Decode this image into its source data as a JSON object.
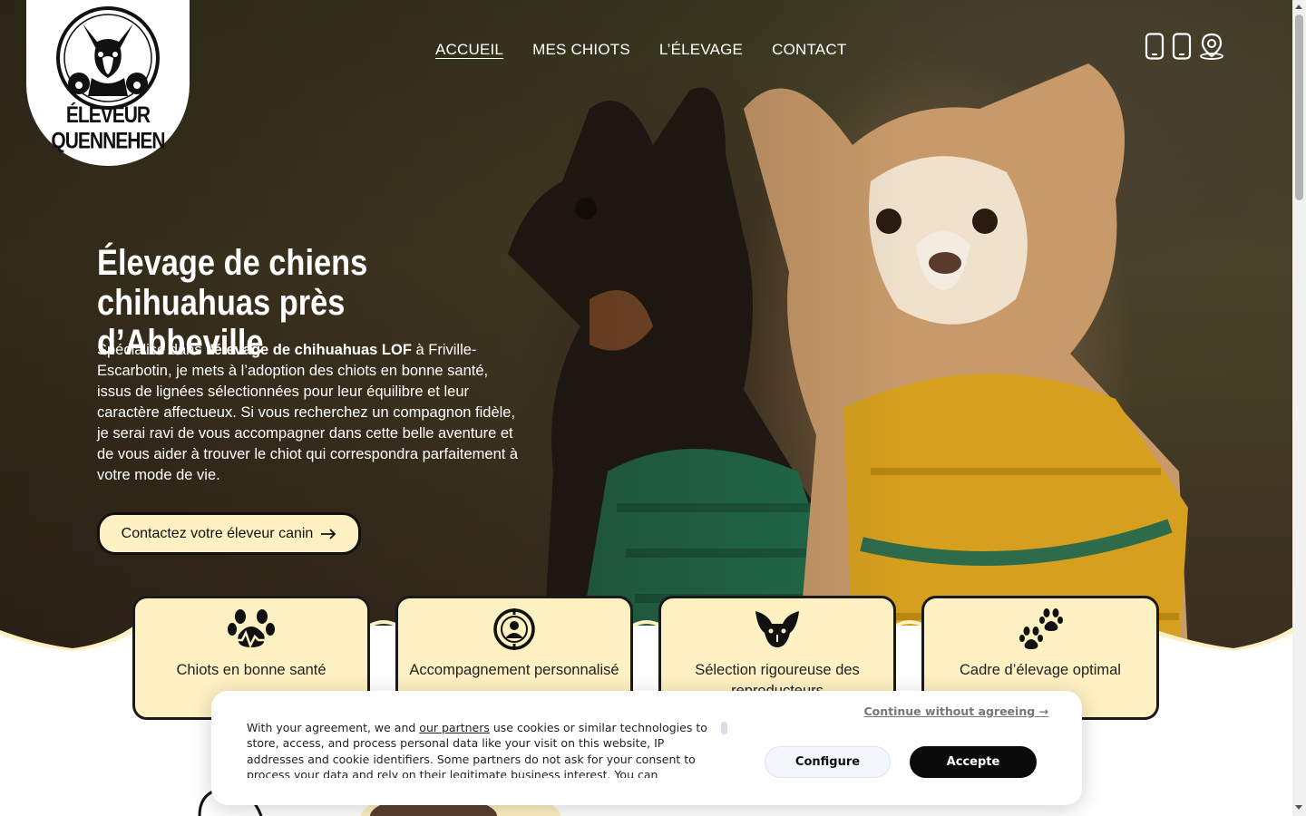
{
  "brand": {
    "name": "ÉLEVEUR QUENNEHEN"
  },
  "nav": {
    "items": [
      {
        "label": "ACCUEIL",
        "active": true
      },
      {
        "label": "MES CHIOTS",
        "active": false
      },
      {
        "label": "L’ÉLEVAGE",
        "active": false
      },
      {
        "label": "CONTACT",
        "active": false
      }
    ]
  },
  "top_icons": [
    "phone-icon",
    "mobile-icon",
    "location-pin-icon"
  ],
  "hero": {
    "title": "Élevage de chiens chihuahuas près d’Abbeville",
    "text_before": "Spécialisé dans ",
    "text_bold": "l'élevage de chihuahuas LOF",
    "text_after": " à Friville-Escarbotin, je mets à l’adoption des chiots en bonne santé, issus de lignées sélectionnées pour leur équilibre et leur caractère affectueux. Si vous recherchez un compagnon fidèle, je serai ravi de vous accompagner dans cette belle aventure et de vous aider à trouver le chiot qui correspondra parfaitement à votre mode de vie.",
    "cta_label": "Contactez votre éleveur canin",
    "cta_icon": "arrow-right-icon"
  },
  "features": [
    {
      "label": "Chiots en bonne santé",
      "icon": "paw-heartbeat-icon"
    },
    {
      "label": "Accompagnement personnalisé",
      "icon": "support-person-icon"
    },
    {
      "label": "Sélection rigoureuse des reproducteurs",
      "icon": "dog-head-icon"
    },
    {
      "label": "Cadre d’élevage optimal",
      "icon": "paws-icon"
    }
  ],
  "cookie": {
    "skip_label": "Continue without agreeing →",
    "text_before": "With your agreement, we and ",
    "link_label": "our partners",
    "text_after": " use cookies or similar technologies to store, access, and process personal data like your visit on this website, IP addresses and cookie identifiers. Some partners do not ask for your consent to process your data and rely on their legitimate business interest. You can",
    "configure_label": "Configure",
    "accept_label": "Accepte"
  },
  "colors": {
    "accent": "#fdf0c2",
    "dark": "#1a1a1a",
    "hero_bg": "#3b3a22"
  }
}
